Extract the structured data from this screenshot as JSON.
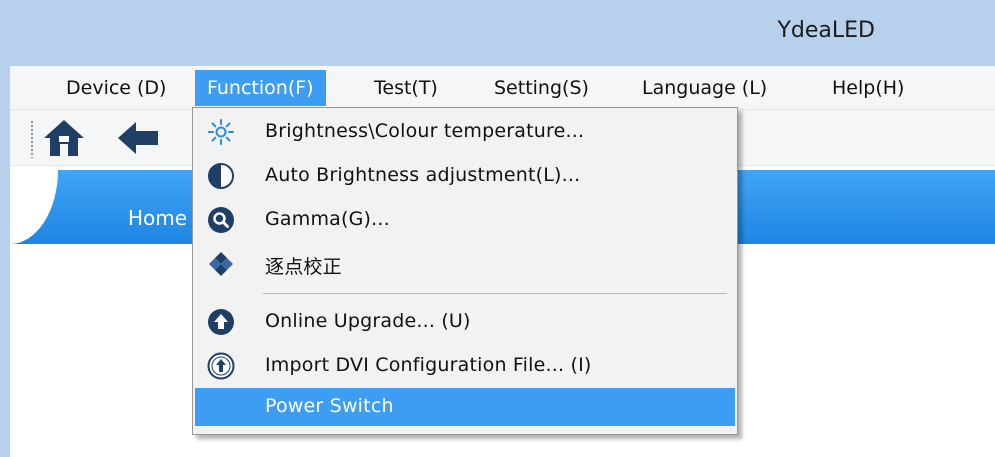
{
  "window": {
    "title": "YdeaLED"
  },
  "menubar": {
    "items": [
      {
        "label": "Device (D)"
      },
      {
        "label": "Function(F)"
      },
      {
        "label": "Test(T)"
      },
      {
        "label": "Setting(S)"
      },
      {
        "label": "Language (L)"
      },
      {
        "label": "Help(H)"
      }
    ],
    "active": "Function(F)"
  },
  "toolbar": {
    "buttons": [
      {
        "icon": "home-icon"
      },
      {
        "icon": "back-arrow-icon"
      }
    ]
  },
  "tabs": {
    "home_label": "Home"
  },
  "function_menu": {
    "items": [
      {
        "label": "Brightness\\Colour temperature...",
        "icon": "sun-icon"
      },
      {
        "label": "Auto Brightness adjustment(L)...",
        "icon": "half-circle-icon"
      },
      {
        "label": "Gamma(G)...",
        "icon": "magnifier-icon"
      },
      {
        "label": "逐点校正",
        "icon": "diamond-grid-icon"
      },
      {
        "label": "Online Upgrade... (U)",
        "icon": "upload-circle-icon"
      },
      {
        "label": "Import DVI Configuration File... (I)",
        "icon": "import-circle-icon"
      },
      {
        "label": "Power Switch",
        "icon": ""
      }
    ],
    "highlighted": "Power Switch"
  },
  "colors": {
    "titlebar": "#b7d0ec",
    "accent": "#3c9df3",
    "tab_strip": "#2a94ee",
    "icon_dark": "#1f3f66"
  }
}
